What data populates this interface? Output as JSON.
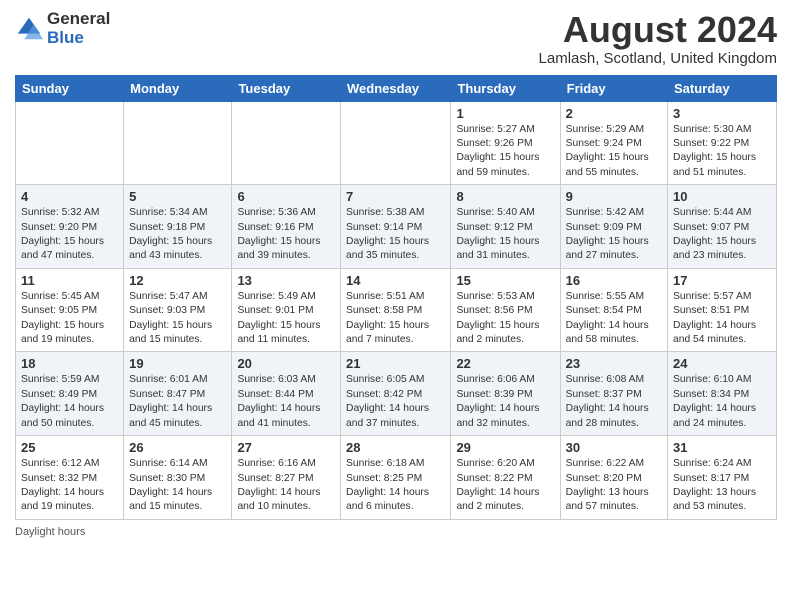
{
  "logo": {
    "general": "General",
    "blue": "Blue"
  },
  "title": "August 2024",
  "location": "Lamlash, Scotland, United Kingdom",
  "days_of_week": [
    "Sunday",
    "Monday",
    "Tuesday",
    "Wednesday",
    "Thursday",
    "Friday",
    "Saturday"
  ],
  "footer_label": "Daylight hours",
  "weeks": [
    [
      {
        "day": "",
        "info": ""
      },
      {
        "day": "",
        "info": ""
      },
      {
        "day": "",
        "info": ""
      },
      {
        "day": "",
        "info": ""
      },
      {
        "day": "1",
        "info": "Sunrise: 5:27 AM\nSunset: 9:26 PM\nDaylight: 15 hours and 59 minutes."
      },
      {
        "day": "2",
        "info": "Sunrise: 5:29 AM\nSunset: 9:24 PM\nDaylight: 15 hours and 55 minutes."
      },
      {
        "day": "3",
        "info": "Sunrise: 5:30 AM\nSunset: 9:22 PM\nDaylight: 15 hours and 51 minutes."
      }
    ],
    [
      {
        "day": "4",
        "info": "Sunrise: 5:32 AM\nSunset: 9:20 PM\nDaylight: 15 hours and 47 minutes."
      },
      {
        "day": "5",
        "info": "Sunrise: 5:34 AM\nSunset: 9:18 PM\nDaylight: 15 hours and 43 minutes."
      },
      {
        "day": "6",
        "info": "Sunrise: 5:36 AM\nSunset: 9:16 PM\nDaylight: 15 hours and 39 minutes."
      },
      {
        "day": "7",
        "info": "Sunrise: 5:38 AM\nSunset: 9:14 PM\nDaylight: 15 hours and 35 minutes."
      },
      {
        "day": "8",
        "info": "Sunrise: 5:40 AM\nSunset: 9:12 PM\nDaylight: 15 hours and 31 minutes."
      },
      {
        "day": "9",
        "info": "Sunrise: 5:42 AM\nSunset: 9:09 PM\nDaylight: 15 hours and 27 minutes."
      },
      {
        "day": "10",
        "info": "Sunrise: 5:44 AM\nSunset: 9:07 PM\nDaylight: 15 hours and 23 minutes."
      }
    ],
    [
      {
        "day": "11",
        "info": "Sunrise: 5:45 AM\nSunset: 9:05 PM\nDaylight: 15 hours and 19 minutes."
      },
      {
        "day": "12",
        "info": "Sunrise: 5:47 AM\nSunset: 9:03 PM\nDaylight: 15 hours and 15 minutes."
      },
      {
        "day": "13",
        "info": "Sunrise: 5:49 AM\nSunset: 9:01 PM\nDaylight: 15 hours and 11 minutes."
      },
      {
        "day": "14",
        "info": "Sunrise: 5:51 AM\nSunset: 8:58 PM\nDaylight: 15 hours and 7 minutes."
      },
      {
        "day": "15",
        "info": "Sunrise: 5:53 AM\nSunset: 8:56 PM\nDaylight: 15 hours and 2 minutes."
      },
      {
        "day": "16",
        "info": "Sunrise: 5:55 AM\nSunset: 8:54 PM\nDaylight: 14 hours and 58 minutes."
      },
      {
        "day": "17",
        "info": "Sunrise: 5:57 AM\nSunset: 8:51 PM\nDaylight: 14 hours and 54 minutes."
      }
    ],
    [
      {
        "day": "18",
        "info": "Sunrise: 5:59 AM\nSunset: 8:49 PM\nDaylight: 14 hours and 50 minutes."
      },
      {
        "day": "19",
        "info": "Sunrise: 6:01 AM\nSunset: 8:47 PM\nDaylight: 14 hours and 45 minutes."
      },
      {
        "day": "20",
        "info": "Sunrise: 6:03 AM\nSunset: 8:44 PM\nDaylight: 14 hours and 41 minutes."
      },
      {
        "day": "21",
        "info": "Sunrise: 6:05 AM\nSunset: 8:42 PM\nDaylight: 14 hours and 37 minutes."
      },
      {
        "day": "22",
        "info": "Sunrise: 6:06 AM\nSunset: 8:39 PM\nDaylight: 14 hours and 32 minutes."
      },
      {
        "day": "23",
        "info": "Sunrise: 6:08 AM\nSunset: 8:37 PM\nDaylight: 14 hours and 28 minutes."
      },
      {
        "day": "24",
        "info": "Sunrise: 6:10 AM\nSunset: 8:34 PM\nDaylight: 14 hours and 24 minutes."
      }
    ],
    [
      {
        "day": "25",
        "info": "Sunrise: 6:12 AM\nSunset: 8:32 PM\nDaylight: 14 hours and 19 minutes."
      },
      {
        "day": "26",
        "info": "Sunrise: 6:14 AM\nSunset: 8:30 PM\nDaylight: 14 hours and 15 minutes."
      },
      {
        "day": "27",
        "info": "Sunrise: 6:16 AM\nSunset: 8:27 PM\nDaylight: 14 hours and 10 minutes."
      },
      {
        "day": "28",
        "info": "Sunrise: 6:18 AM\nSunset: 8:25 PM\nDaylight: 14 hours and 6 minutes."
      },
      {
        "day": "29",
        "info": "Sunrise: 6:20 AM\nSunset: 8:22 PM\nDaylight: 14 hours and 2 minutes."
      },
      {
        "day": "30",
        "info": "Sunrise: 6:22 AM\nSunset: 8:20 PM\nDaylight: 13 hours and 57 minutes."
      },
      {
        "day": "31",
        "info": "Sunrise: 6:24 AM\nSunset: 8:17 PM\nDaylight: 13 hours and 53 minutes."
      }
    ]
  ]
}
